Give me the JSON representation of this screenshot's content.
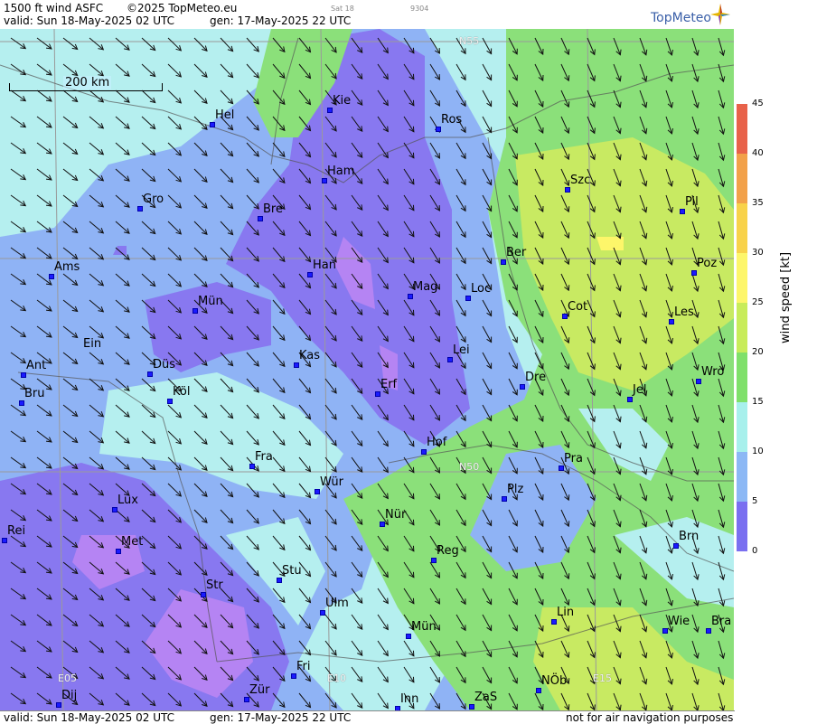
{
  "header": {
    "product": "1500 ft wind ASFC",
    "copyright": "©2025 TopMeteo.eu",
    "sat_label": "Sat 18",
    "code": "9304",
    "valid": "valid:  Sun  18-May-2025  02 UTC",
    "gen": "gen: 17-May-2025 22 UTC"
  },
  "logo": {
    "text": "TopMeteo",
    "icon": "compass-star-icon"
  },
  "footer": {
    "valid": "valid:  Sun  18-May-2025  02 UTC",
    "gen": "gen: 17-May-2025 22 UTC",
    "note": "not for air navigation purposes"
  },
  "scale": {
    "label": "200 km"
  },
  "grid_labels": {
    "n55": "N55",
    "n50": "N50",
    "e05": "E05",
    "e10": "E10",
    "e15": "E15"
  },
  "cities": [
    "Hel",
    "Kie",
    "Ros",
    "Ham",
    "Gro",
    "Bre",
    "Szc",
    "Pil",
    "Ber",
    "Ams",
    "Han",
    "Poz",
    "Mag",
    "Loc",
    "Mün",
    "Cot",
    "Les",
    "Ein",
    "Lei",
    "Kas",
    "Ant",
    "Düs",
    "Wro",
    "Dre",
    "Erf",
    "Bru",
    "Köl",
    "Jel",
    "Hof",
    "Fra",
    "Pra",
    "Würz",
    "Lux",
    "Plz",
    "Rei",
    "Nür",
    "Met",
    "Reg",
    "Stu",
    "Brn",
    "Str",
    "Lin",
    "Ulm",
    "Wie",
    "Bra",
    "Mün2",
    "Fri",
    "Dij",
    "Zür",
    "NÖb",
    "Inn",
    "ZaS"
  ],
  "city_labels": {
    "Hel": "Hel",
    "Kie": "Kie",
    "Ros": "Ros",
    "Ham": "Ham",
    "Gro": "Gro",
    "Bre": "Bre",
    "Szc": "Szc",
    "Pil": "Pil",
    "Ber": "Ber",
    "Ams": "Ams",
    "Han": "Han",
    "Poz": "Poz",
    "Mag": "Mag",
    "Loc": "Loc",
    "Mün": "Mün",
    "Cot": "Cot",
    "Les": "Les",
    "Ein": "Ein",
    "Lei": "Lei",
    "Kas": "Kas",
    "Ant": "Ant",
    "Düs": "Düs",
    "Wro": "Wro",
    "Dre": "Dre",
    "Erf": "Erf",
    "Bru": "Bru",
    "Köl": "Köl",
    "Jel": "Jel",
    "Hof": "Hof",
    "Fra": "Fra",
    "Pra": "Pra",
    "Würz": "Wür",
    "Lux": "Lux",
    "Plz": "Plz",
    "Rei": "Rei",
    "Nür": "Nür",
    "Met": "Met",
    "Reg": "Reg",
    "Stu": "Stu",
    "Brn": "Brn",
    "Str": "Str",
    "Lin": "Lin",
    "Ulm": "Ulm",
    "Wie": "Wie",
    "Bra": "Bra",
    "Mün2": "Mün",
    "Fri": "Fri",
    "Dij": "Dij",
    "Zür": "Zür",
    "NÖb": "NÖb",
    "Inn": "Inn",
    "ZaS": "ZaS"
  },
  "legend": {
    "axis_label": "wind speed  [kt]",
    "ticks": [
      "45",
      "40",
      "35",
      "30",
      "25",
      "20",
      "15",
      "10",
      "5",
      "0"
    ],
    "colors": [
      "#e8624a",
      "#f2a14a",
      "#f8d24a",
      "#fdf66a",
      "#c8ec5a",
      "#7fe06a",
      "#a7f0ec",
      "#8cb8f5",
      "#7a6ff0",
      "#c890f5"
    ]
  },
  "map_colors": {
    "light_blue": "#b5efef",
    "blue": "#8fb3f5",
    "purple": "#8878f0",
    "violet": "#b584f3",
    "green": "#8be07a",
    "yellowgreen": "#c8ea62"
  }
}
